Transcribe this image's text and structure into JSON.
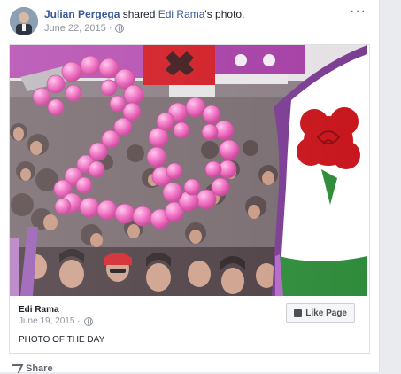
{
  "post": {
    "author": "Julian Pergega",
    "action_text": " shared ",
    "shared_from": "Edi Rama",
    "object_text": "'s photo.",
    "date": "June 22, 2015 · ",
    "more": "···"
  },
  "shared_photo": {
    "page_name": "Edi Rama",
    "date": "June 19, 2015 · ",
    "caption": "PHOTO OF THE DAY",
    "like_page_label": "Like Page"
  },
  "actions": {
    "share_label": "Share"
  },
  "icons": {
    "privacy": "globe-icon",
    "like": "thumbs-up-icon",
    "share": "share-arrow-icon"
  },
  "colors": {
    "link": "#385898",
    "balloon_pink": "#ea5fb8",
    "flag_red": "#c8161d",
    "flag_purple": "#8b3e9b",
    "rose_green": "#2f8c3b"
  }
}
